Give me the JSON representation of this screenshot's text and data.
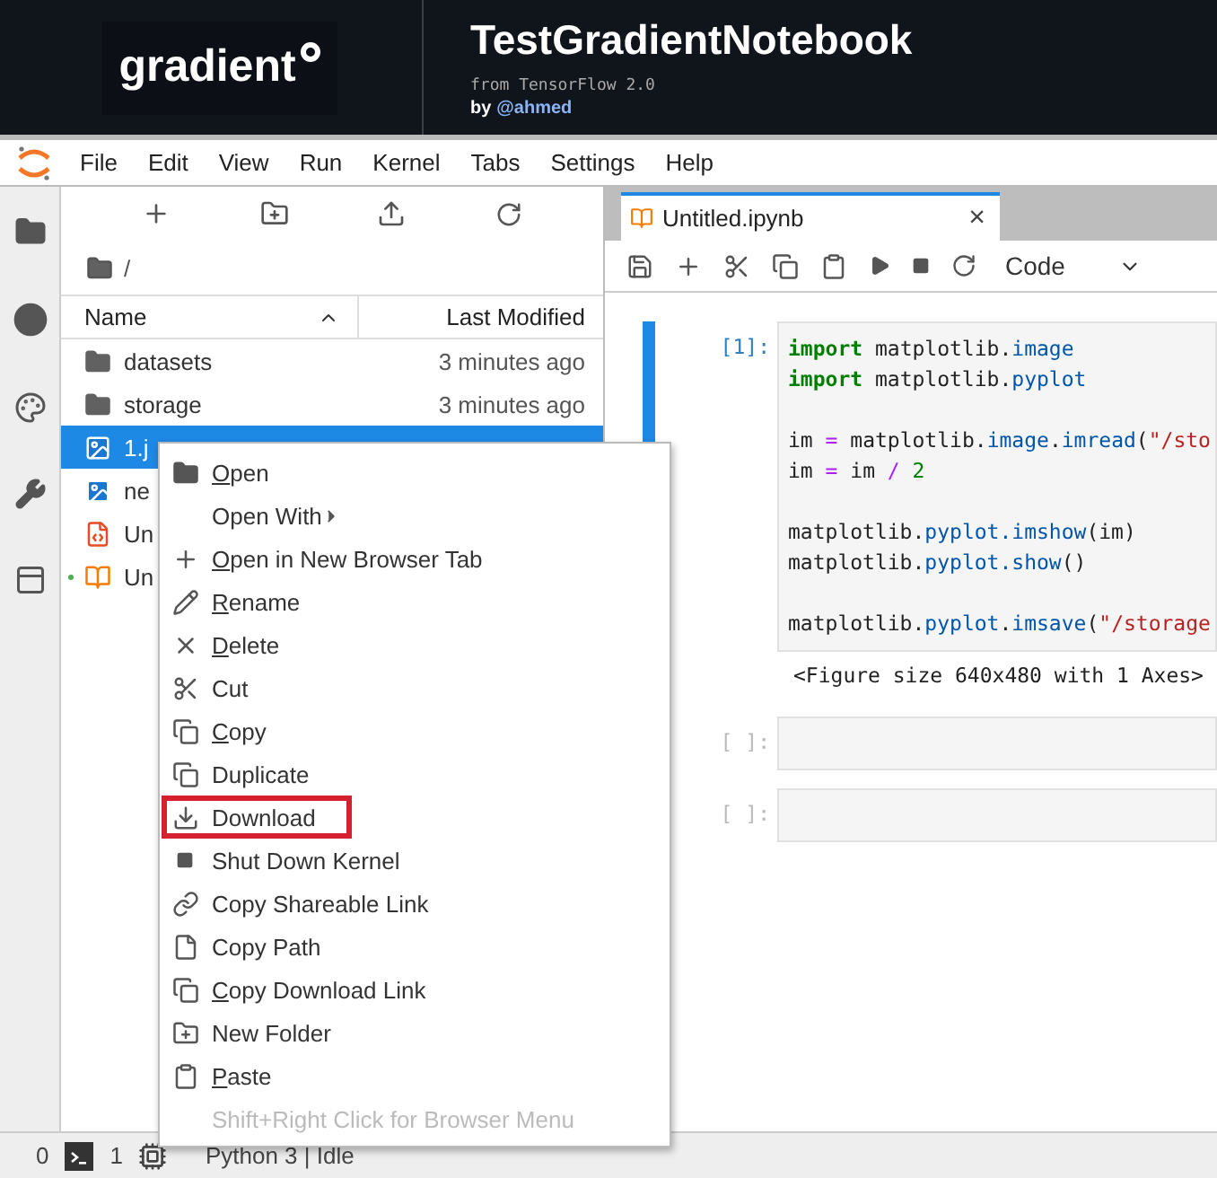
{
  "header": {
    "logo": "gradient",
    "title": "TestGradientNotebook",
    "subtitle": "from TensorFlow 2.0",
    "byline": "by",
    "author": "@ahmed"
  },
  "menubar": [
    "File",
    "Edit",
    "View",
    "Run",
    "Kernel",
    "Tabs",
    "Settings",
    "Help"
  ],
  "file_browser": {
    "breadcrumb": "/",
    "columns": [
      "Name",
      "Last Modified"
    ],
    "rows": [
      {
        "kind": "folder",
        "name": "datasets",
        "modified": "3 minutes ago",
        "selected": false,
        "running": false
      },
      {
        "kind": "folder",
        "name": "storage",
        "modified": "3 minutes ago",
        "selected": false,
        "running": false
      },
      {
        "kind": "image",
        "name": "1.j",
        "selected": true,
        "running": false
      },
      {
        "kind": "image",
        "name": "ne",
        "selected": false,
        "running": false
      },
      {
        "kind": "html",
        "name": "Un",
        "selected": false,
        "running": false
      },
      {
        "kind": "notebook",
        "name": "Un",
        "selected": false,
        "running": true
      }
    ]
  },
  "notebook": {
    "tab": {
      "title": "Untitled.ipynb",
      "close": "×"
    },
    "cell_type": "Code",
    "cells": [
      {
        "prompt": "[1]:",
        "active": true,
        "blocks": [
          [
            [
              {
                "kind": "keyword",
                "text": "import"
              },
              {
                "kind": "plain",
                "text": " matplotlib."
              },
              {
                "kind": "attr",
                "text": "image"
              }
            ],
            [
              {
                "kind": "keyword",
                "text": "import"
              },
              {
                "kind": "plain",
                "text": " matplotlib."
              },
              {
                "kind": "attr",
                "text": "pyplot"
              }
            ]
          ],
          [
            [
              {
                "kind": "plain",
                "text": "im "
              },
              {
                "kind": "op",
                "text": "="
              },
              {
                "kind": "plain",
                "text": " matplotlib."
              },
              {
                "kind": "attr",
                "text": "image"
              },
              {
                "kind": "plain",
                "text": "."
              },
              {
                "kind": "attr",
                "text": "imread"
              },
              {
                "kind": "plain",
                "text": "("
              },
              {
                "kind": "string",
                "text": "\"/sto"
              }
            ],
            [
              {
                "kind": "plain",
                "text": "im "
              },
              {
                "kind": "op",
                "text": "="
              },
              {
                "kind": "plain",
                "text": " im "
              },
              {
                "kind": "op",
                "text": "/"
              },
              {
                "kind": "number",
                "text": " 2"
              }
            ]
          ],
          [
            [
              {
                "kind": "plain",
                "text": "matplotlib."
              },
              {
                "kind": "attr",
                "text": "pyplot"
              },
              {
                "kind": "attr",
                "text": ".imshow"
              },
              {
                "kind": "plain",
                "text": "(im)"
              }
            ],
            [
              {
                "kind": "plain",
                "text": "matplotlib."
              },
              {
                "kind": "attr",
                "text": "pyplot"
              },
              {
                "kind": "attr",
                "text": ".show"
              },
              {
                "kind": "plain",
                "text": "()"
              }
            ]
          ],
          [
            [
              {
                "kind": "plain",
                "text": "matplotlib."
              },
              {
                "kind": "attr",
                "text": "pyplot"
              },
              {
                "kind": "plain",
                "text": "."
              },
              {
                "kind": "attr",
                "text": "imsave"
              },
              {
                "kind": "plain",
                "text": "("
              },
              {
                "kind": "string",
                "text": "\"/storage"
              }
            ]
          ]
        ],
        "output": "<Figure size 640x480 with 1 Axes>"
      },
      {
        "prompt": "[ ]:"
      },
      {
        "prompt": "[ ]:"
      }
    ]
  },
  "context_menu": [
    {
      "label": "Open",
      "underline_first": true
    },
    {
      "label": "Open With",
      "submenu": true
    },
    {
      "label": "Open in New Browser Tab",
      "underline_first": true
    },
    {
      "label": "Rename",
      "underline_first": true
    },
    {
      "label": "Delete",
      "underline_first": true
    },
    {
      "label": "Cut"
    },
    {
      "label": "Copy",
      "underline_first": true
    },
    {
      "label": "Duplicate"
    },
    {
      "label": "Download",
      "annotated": true
    },
    {
      "label": "Shut Down Kernel"
    },
    {
      "label": "Copy Shareable Link"
    },
    {
      "label": "Copy Path"
    },
    {
      "label": "Copy Download Link",
      "underline_first": true
    },
    {
      "label": "New Folder"
    },
    {
      "label": "Paste",
      "underline_first": true
    },
    {
      "label": "Shift+Right Click for Browser Menu",
      "disabled": true
    }
  ],
  "status_bar": {
    "terminals": "0",
    "kernels": "1",
    "kernel_status": "Python 3 | Idle"
  }
}
